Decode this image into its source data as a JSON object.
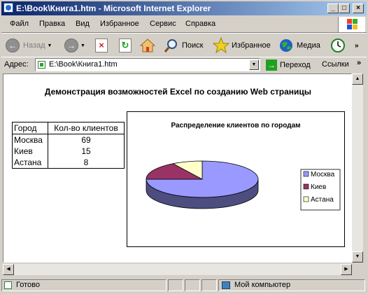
{
  "window": {
    "title": "E:\\Book\\Книга1.htm - Microsoft Internet Explorer",
    "controls": {
      "minimize": "_",
      "maximize": "□",
      "close": "×"
    }
  },
  "menu": [
    "Файл",
    "Правка",
    "Вид",
    "Избранное",
    "Сервис",
    "Справка"
  ],
  "toolbar": {
    "back": "Назад",
    "search": "Поиск",
    "favorites": "Избранное",
    "media": "Медиа"
  },
  "address": {
    "label": "Адрес:",
    "value": "E:\\Book\\Книга1.htm",
    "go": "Переход",
    "links": "Ссылки",
    "more": "»"
  },
  "page": {
    "heading": "Демонстрация возможностей Excel по созданию Web страницы",
    "table": {
      "headers": [
        "Город",
        "Кол-во клиентов"
      ],
      "rows": [
        [
          "Москва",
          "69"
        ],
        [
          "Киев",
          "15"
        ],
        [
          "Астана",
          "8"
        ]
      ]
    }
  },
  "chart_data": {
    "type": "pie",
    "title": "Распределение клиентов по городам",
    "categories": [
      "Москва",
      "Киев",
      "Астана"
    ],
    "values": [
      69,
      15,
      8
    ],
    "colors": [
      "#9999ff",
      "#993366",
      "#ffffcc"
    ],
    "legend": "right",
    "three_d": true
  },
  "status": {
    "text": "Готово",
    "zone": "Мой компьютер"
  }
}
